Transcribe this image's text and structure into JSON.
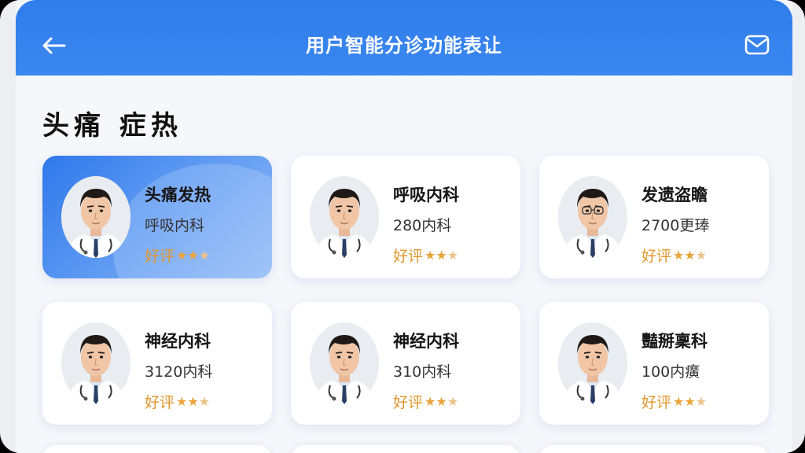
{
  "header": {
    "title": "用户智能分诊功能表让",
    "back_icon": "arrow-left-icon",
    "mail_icon": "mail-icon"
  },
  "section": {
    "title": "头痛 症热"
  },
  "colors": {
    "header": "#2F7DEB",
    "rating": "#E0962A",
    "active_card": "#2F78EA"
  },
  "doctors": [
    {
      "name": "头痛发热",
      "sub": "呼吸内科",
      "rating_label": "好评",
      "stars": 3,
      "active": true
    },
    {
      "name": "呼吸内科",
      "sub": "280内科",
      "rating_label": "好评",
      "stars": 3,
      "active": false
    },
    {
      "name": "发遗盗瞻",
      "sub": "2700更琫",
      "rating_label": "好评",
      "stars": 3,
      "active": false,
      "glasses": true
    },
    {
      "name": "神经内科",
      "sub": "3120内科",
      "rating_label": "好评",
      "stars": 3,
      "active": false
    },
    {
      "name": "神经内科",
      "sub": "310内科",
      "rating_label": "好评",
      "stars": 3,
      "active": false
    },
    {
      "name": "豔掰稟科",
      "sub": "100内癀",
      "rating_label": "好评",
      "stars": 3,
      "active": false
    }
  ]
}
